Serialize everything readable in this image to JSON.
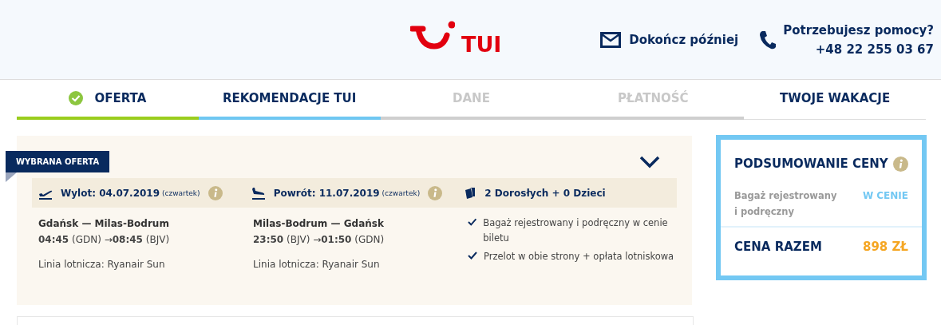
{
  "header": {
    "logo_text": "TUI",
    "save_link": "Dokończ później",
    "help_title": "Potrzebujesz pomocy?",
    "help_phone": "+48 22 255 03 67"
  },
  "steps": [
    {
      "label": "OFERTA",
      "completed": true,
      "selected": false,
      "disabled": false
    },
    {
      "label": "REKOMENDACJE TUI",
      "completed": false,
      "selected": true,
      "disabled": false
    },
    {
      "label": "DANE",
      "completed": false,
      "selected": false,
      "disabled": true
    },
    {
      "label": "PŁATNOŚĆ",
      "completed": false,
      "selected": false,
      "disabled": true
    },
    {
      "label": "TWOJE WAKACJE",
      "completed": false,
      "selected": false,
      "disabled": false
    }
  ],
  "offer": {
    "badge": "WYBRANA OFERTA",
    "expanded": false,
    "legs": [
      {
        "kind": "departure",
        "title": "Wylot: 04.07.2019",
        "day": "(czwartek)",
        "route": "Gdańsk — Milas-Bodrum",
        "times": "**04:45** (GDN) →**08:45** (BJV)",
        "airline": "Linia lotnicza: Ryanair Sun"
      },
      {
        "kind": "return",
        "title": "Powrót: 11.07.2019",
        "day": "(czwartek)",
        "route": "Milas-Bodrum — Gdańsk",
        "times": "**23:50** (BJV) →**01:50** (GDN)",
        "airline": "Linia lotnicza: Ryanair Sun"
      }
    ],
    "passengers": "2 Dorosłych + 0 Dzieci",
    "includes": [
      "Bagaż rejestrowany i podręczny w cenie biletu",
      "Przelot w obie strony + opłata lotniskowa"
    ]
  },
  "summary": {
    "title": "PODSUMOWANIE CENY",
    "items": [
      {
        "label": "Bagaż rejestrowany i podręczny",
        "value": "W CENIE"
      }
    ],
    "total_label": "CENA RAZEM",
    "total": "898 ZŁ"
  }
}
